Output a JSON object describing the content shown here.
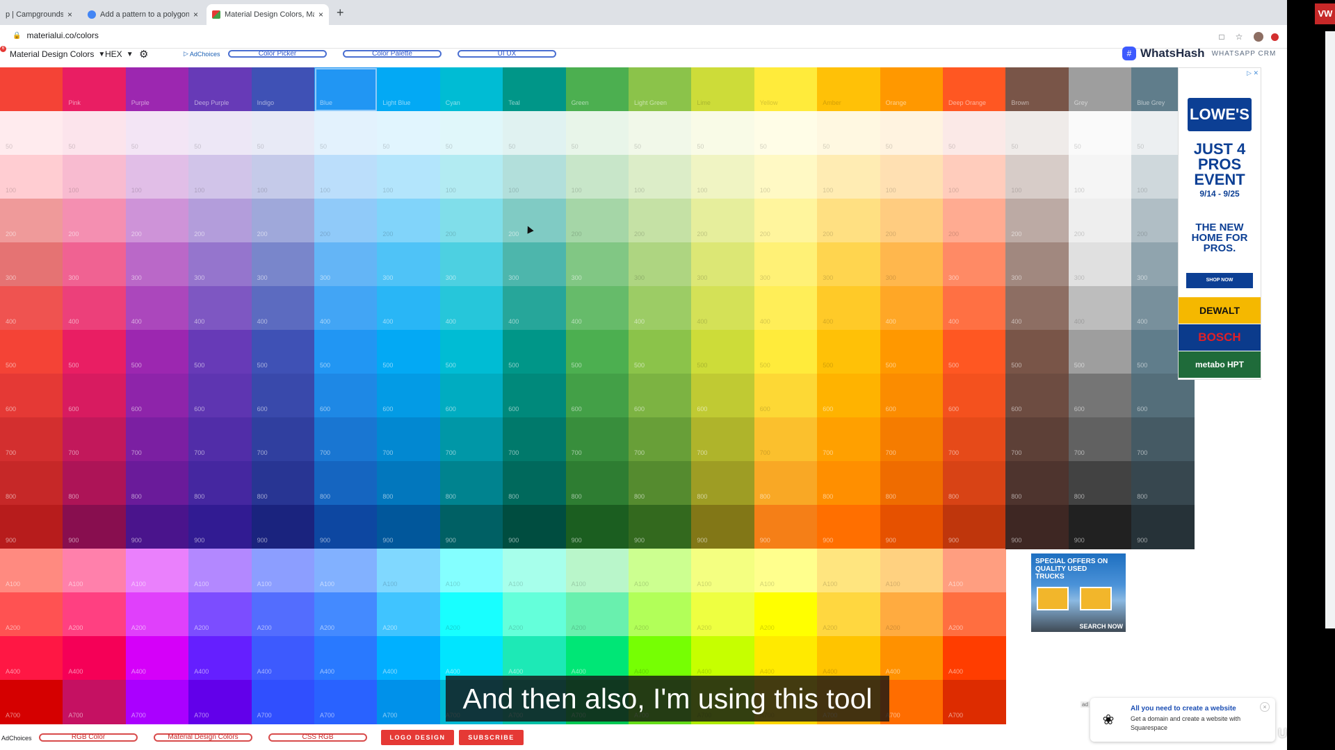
{
  "browser": {
    "tabs": [
      {
        "title": "p | Campgrounds Ind",
        "favicon_color": "#9aa0a6",
        "active": false
      },
      {
        "title": "Add a pattern to a polygon | M",
        "favicon_color": "#4285f4",
        "active": false
      },
      {
        "title": "Material Design Colors, Materi",
        "favicon_color": "#e53935",
        "active": true
      }
    ],
    "close_glyph": "×",
    "new_tab_glyph": "+",
    "url": "materialui.co/colors"
  },
  "header": {
    "notification_count": "6",
    "palette_select": "Material Design Colors",
    "format_select": "HEX",
    "adchoices": "AdChoices",
    "nav_links": [
      "Color Picker",
      "Color Palette",
      "UI UX"
    ],
    "brand_name": "WhatsHash",
    "brand_tagline": "WHATSAPP CRM"
  },
  "palette": {
    "families": [
      "",
      "Pink",
      "Purple",
      "Deep Purple",
      "Indigo",
      "Blue",
      "Light Blue",
      "Cyan",
      "Teal",
      "Green",
      "Light Green",
      "Lime",
      "Yellow",
      "Amber",
      "Orange",
      "Deep Orange",
      "Brown",
      "Grey",
      "Blue Grey"
    ],
    "shades": [
      "",
      "50",
      "100",
      "200",
      "300",
      "400",
      "500",
      "600",
      "700",
      "800",
      "900",
      "A100",
      "A200",
      "A400",
      "A700"
    ],
    "selected_family": "Blue",
    "colors": [
      [
        "#f44336",
        "#ffebee",
        "#ffcdd2",
        "#ef9a9a",
        "#e57373",
        "#ef5350",
        "#f44336",
        "#e53935",
        "#d32f2f",
        "#c62828",
        "#b71c1c",
        "#ff8a80",
        "#ff5252",
        "#ff1744",
        "#d50000"
      ],
      [
        "#e91e63",
        "#fce4ec",
        "#f8bbd0",
        "#f48fb1",
        "#f06292",
        "#ec407a",
        "#e91e63",
        "#d81b60",
        "#c2185b",
        "#ad1457",
        "#880e4f",
        "#ff80ab",
        "#ff4081",
        "#f50057",
        "#c51162"
      ],
      [
        "#9c27b0",
        "#f3e5f5",
        "#e1bee7",
        "#ce93d8",
        "#ba68c8",
        "#ab47bc",
        "#9c27b0",
        "#8e24aa",
        "#7b1fa2",
        "#6a1b9a",
        "#4a148c",
        "#ea80fc",
        "#e040fb",
        "#d500f9",
        "#aa00ff"
      ],
      [
        "#673ab7",
        "#ede7f6",
        "#d1c4e9",
        "#b39ddb",
        "#9575cd",
        "#7e57c2",
        "#673ab7",
        "#5e35b1",
        "#512da8",
        "#4527a0",
        "#311b92",
        "#b388ff",
        "#7c4dff",
        "#651fff",
        "#6200ea"
      ],
      [
        "#3f51b5",
        "#e8eaf6",
        "#c5cae9",
        "#9fa8da",
        "#7986cb",
        "#5c6bc0",
        "#3f51b5",
        "#3949ab",
        "#303f9f",
        "#283593",
        "#1a237e",
        "#8c9eff",
        "#536dfe",
        "#3d5afe",
        "#304ffe"
      ],
      [
        "#2196f3",
        "#e3f2fd",
        "#bbdefb",
        "#90caf9",
        "#64b5f6",
        "#42a5f5",
        "#2196f3",
        "#1e88e5",
        "#1976d2",
        "#1565c0",
        "#0d47a1",
        "#82b1ff",
        "#448aff",
        "#2979ff",
        "#2962ff"
      ],
      [
        "#03a9f4",
        "#e1f5fe",
        "#b3e5fc",
        "#81d4fa",
        "#4fc3f7",
        "#29b6f6",
        "#03a9f4",
        "#039be5",
        "#0288d1",
        "#0277bd",
        "#01579b",
        "#80d8ff",
        "#40c4ff",
        "#00b0ff",
        "#0091ea"
      ],
      [
        "#00bcd4",
        "#e0f7fa",
        "#b2ebf2",
        "#80deea",
        "#4dd0e1",
        "#26c6da",
        "#00bcd4",
        "#00acc1",
        "#0097a7",
        "#00838f",
        "#006064",
        "#84ffff",
        "#18ffff",
        "#00e5ff",
        "#00b8d4"
      ],
      [
        "#009688",
        "#e0f2f1",
        "#b2dfdb",
        "#80cbc4",
        "#4db6ac",
        "#26a69a",
        "#009688",
        "#00897b",
        "#00796b",
        "#00695c",
        "#004d40",
        "#a7ffeb",
        "#64ffda",
        "#1de9b6",
        "#00bfa5"
      ],
      [
        "#4caf50",
        "#e8f5e9",
        "#c8e6c9",
        "#a5d6a7",
        "#81c784",
        "#66bb6a",
        "#4caf50",
        "#43a047",
        "#388e3c",
        "#2e7d32",
        "#1b5e20",
        "#b9f6ca",
        "#69f0ae",
        "#00e676",
        "#00c853"
      ],
      [
        "#8bc34a",
        "#f1f8e9",
        "#dcedc8",
        "#c5e1a5",
        "#aed581",
        "#9ccc65",
        "#8bc34a",
        "#7cb342",
        "#689f38",
        "#558b2f",
        "#33691e",
        "#ccff90",
        "#b2ff59",
        "#76ff03",
        "#64dd17"
      ],
      [
        "#cddc39",
        "#f9fbe7",
        "#f0f4c3",
        "#e6ee9c",
        "#dce775",
        "#d4e157",
        "#cddc39",
        "#c0ca33",
        "#afb42b",
        "#9e9d24",
        "#827717",
        "#f4ff81",
        "#eeff41",
        "#c6ff00",
        "#aeea00"
      ],
      [
        "#ffeb3b",
        "#fffde7",
        "#fff9c4",
        "#fff59d",
        "#fff176",
        "#ffee58",
        "#ffeb3b",
        "#fdd835",
        "#fbc02d",
        "#f9a825",
        "#f57f17",
        "#ffff8d",
        "#ffff00",
        "#ffea00",
        "#ffd600"
      ],
      [
        "#ffc107",
        "#fff8e1",
        "#ffecb3",
        "#ffe082",
        "#ffd54f",
        "#ffca28",
        "#ffc107",
        "#ffb300",
        "#ffa000",
        "#ff8f00",
        "#ff6f00",
        "#ffe57f",
        "#ffd740",
        "#ffc400",
        "#ffab00"
      ],
      [
        "#ff9800",
        "#fff3e0",
        "#ffe0b2",
        "#ffcc80",
        "#ffb74d",
        "#ffa726",
        "#ff9800",
        "#fb8c00",
        "#f57c00",
        "#ef6c00",
        "#e65100",
        "#ffd180",
        "#ffab40",
        "#ff9100",
        "#ff6d00"
      ],
      [
        "#ff5722",
        "#fbe9e7",
        "#ffccbc",
        "#ffab91",
        "#ff8a65",
        "#ff7043",
        "#ff5722",
        "#f4511e",
        "#e64a19",
        "#d84315",
        "#bf360c",
        "#ff9e80",
        "#ff6e40",
        "#ff3d00",
        "#dd2c00"
      ],
      [
        "#795548",
        "#efebe9",
        "#d7ccc8",
        "#bcaaa4",
        "#a1887f",
        "#8d6e63",
        "#795548",
        "#6d4c41",
        "#5d4037",
        "#4e342e",
        "#3e2723",
        "",
        "",
        "",
        ""
      ],
      [
        "#9e9e9e",
        "#fafafa",
        "#f5f5f5",
        "#eeeeee",
        "#e0e0e0",
        "#bdbdbd",
        "#9e9e9e",
        "#757575",
        "#616161",
        "#424242",
        "#212121",
        "",
        "",
        "",
        ""
      ],
      [
        "#607d8b",
        "#eceff1",
        "#cfd8dc",
        "#b0bec5",
        "#90a4ae",
        "#78909c",
        "#607d8b",
        "#546e7a",
        "#455a64",
        "#37474f",
        "#263238",
        "",
        "",
        "",
        ""
      ]
    ]
  },
  "ads": {
    "lowes": {
      "brand": "LOWE'S",
      "headline": "JUST 4 PROS EVENT",
      "dates": "9/14 - 9/25",
      "body": "THE NEW HOME FOR PROS.",
      "cta": "SHOP NOW",
      "brands": [
        {
          "name": "DEWALT",
          "bg": "#f5b800",
          "fg": "#111111"
        },
        {
          "name": "BOSCH",
          "bg": "#0b3b8c",
          "fg": "#e21f26"
        },
        {
          "name": "metabo HPT",
          "bg": "#1f6b3a",
          "fg": "#ffffff"
        }
      ]
    },
    "trucks": {
      "headline": "SPECIAL OFFERS ON QUALITY USED TRUCKS",
      "cta": "SEARCH NOW"
    },
    "popup": {
      "tag": "ad",
      "title": "All you need to create a website",
      "body": "Get a domain and create a website with Squarespace",
      "close": "×"
    }
  },
  "footer": {
    "adchoices": "AdChoices",
    "links": [
      "RGB Color",
      "Material Design Colors",
      "CSS RGB"
    ],
    "buttons": [
      "LOGO DESIGN",
      "SUBSCRIBE"
    ]
  },
  "overlay": {
    "caption": "And then also, I'm using this tool",
    "watermark": "Udemy",
    "app_badge": "VW"
  }
}
